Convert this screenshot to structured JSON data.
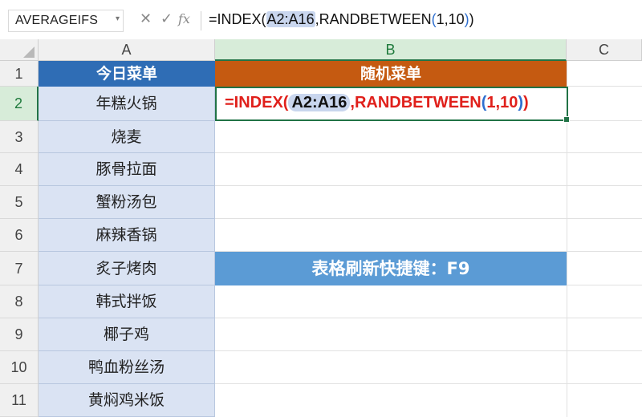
{
  "formula_bar": {
    "name_box": "AVERAGEIFS",
    "cancel_icon": "✕",
    "enter_icon": "✓",
    "fx_label": "fx",
    "formula_prefix": "=INDEX(",
    "formula_range": "A2:A16",
    "formula_mid": ",RANDBETWEEN",
    "formula_open": "(",
    "formula_args": "1,10",
    "formula_close1": ")",
    "formula_close2": ")"
  },
  "columns": [
    "A",
    "B",
    "C"
  ],
  "rows": [
    "1",
    "2",
    "3",
    "4",
    "5",
    "6",
    "7",
    "8",
    "9",
    "10",
    "11"
  ],
  "header_a": "今日菜单",
  "header_b": "随机菜单",
  "menu_items": [
    "年糕火锅",
    "烧麦",
    "豚骨拉面",
    "蟹粉汤包",
    "麻辣香锅",
    "炙子烤肉",
    "韩式拌饭",
    "椰子鸡",
    "鸭血粉丝汤",
    "黄焖鸡米饭"
  ],
  "edit_cell": {
    "prefix": "=INDEX(",
    "range": "A2:A16",
    "mid": ",RANDBETWEEN",
    "open": "(",
    "args": "1,10",
    "close1": ")",
    "close2": ")"
  },
  "banner_text": "表格刷新快捷键：F9",
  "colors": {
    "header_a": "#2f6db5",
    "header_b": "#c55a11",
    "column_a_fill": "#dae3f3",
    "banner": "#5b9bd5",
    "selection": "#217346",
    "formula_red": "#e0201b"
  }
}
